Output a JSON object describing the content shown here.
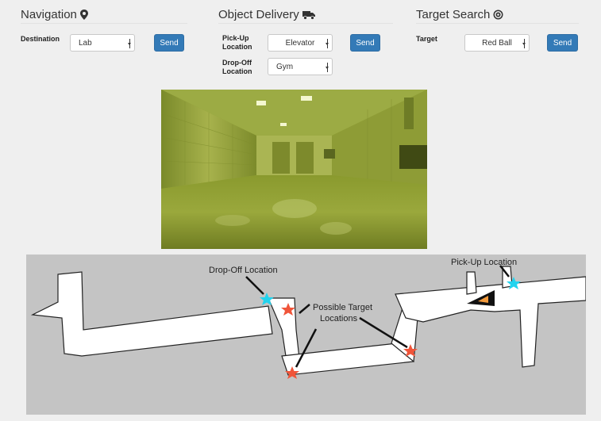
{
  "navigation": {
    "title": "Navigation",
    "icon": "map-marker-icon",
    "destination_label": "Destination",
    "destination_value": "Lab",
    "send_label": "Send"
  },
  "delivery": {
    "title": "Object Delivery",
    "icon": "truck-icon",
    "pickup_label_1": "Pick-Up",
    "pickup_label_2": "Location",
    "pickup_value": "Elevator",
    "dropoff_label_1": "Drop-Off",
    "dropoff_label_2": "Location",
    "dropoff_value": "Gym",
    "send_label": "Send"
  },
  "search": {
    "title": "Target Search",
    "icon": "bullseye-icon",
    "target_label": "Target",
    "target_value": "Red Ball",
    "send_label": "Send"
  },
  "map": {
    "dropoff_annotation": "Drop-Off Location",
    "pickup_annotation": "Pick-Up Location",
    "targets_annotation_1": "Possible Target",
    "targets_annotation_2": "Locations",
    "colors": {
      "pickup_dropoff_star": "#22d3ee",
      "target_star": "#f0553a",
      "robot": "#111111",
      "robot_fill": "#f29a3c"
    }
  },
  "colors": {
    "accent": "#337ab7",
    "background": "#efefef"
  }
}
